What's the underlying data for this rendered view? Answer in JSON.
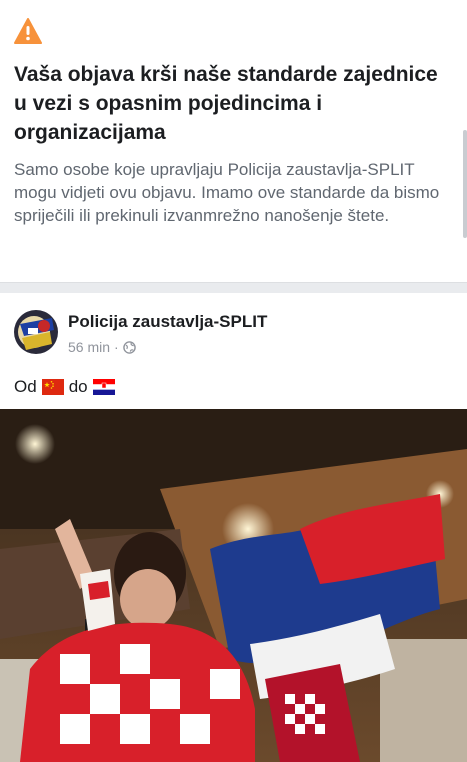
{
  "notice": {
    "icon": "warning-triangle-icon",
    "accent": "#f7923b",
    "title": "Vaša objava krši naše standarde zajednice u vezi s opasnim pojedincima i organizacijama",
    "body": "Samo osobe koje upravljaju Policija zaustavlja-SPLIT mogu vidjeti ovu objavu.  Imamo ove standarde da bismo spriječili ili prekinuli izvanmrežno nanošenje štete."
  },
  "post": {
    "page_name": "Policija zaustavlja-SPLIT",
    "time": "56 min",
    "separator": "·",
    "audience_icon": "globe-icon",
    "text_before": "Od",
    "text_middle": "do",
    "flag_from": "china-flag-icon",
    "flag_to": "croatia-flag-icon"
  }
}
